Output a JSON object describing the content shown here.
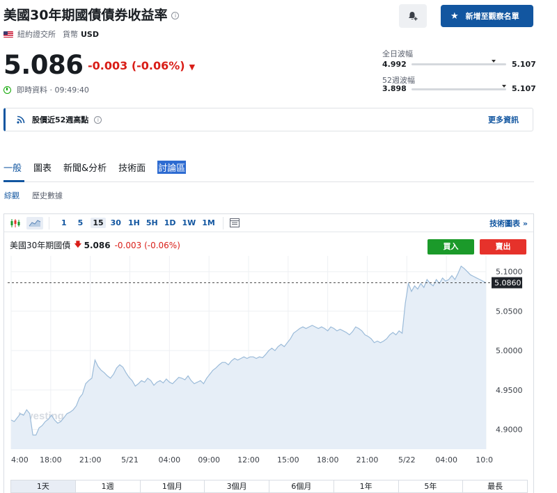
{
  "header": {
    "title": "美國30年期國債債券收益率",
    "info_glyph": "i",
    "exchange": "紐約證交所",
    "currency_label": "貨幣",
    "currency": "USD",
    "watchlist_button": "新增至觀察名單",
    "alert_icon": "bell-plus-icon"
  },
  "quote": {
    "price": "5.086",
    "change": "-0.003",
    "change_pct": "(-0.06%)",
    "status": "即時資料 · 09:49:40",
    "down_color": "#d91e18"
  },
  "ranges": {
    "day_label": "全日波幅",
    "day_low": "4.992",
    "day_high": "5.107",
    "day_position": 0.87,
    "week52_label": "52週波幅",
    "week52_low": "3.898",
    "week52_high": "5.107",
    "week52_position": 0.98
  },
  "alert_banner": {
    "text": "股價近52週高點",
    "more": "更多資訊"
  },
  "tabs": [
    "一般",
    "圖表",
    "新聞&分析",
    "技術面",
    "討論區"
  ],
  "subtabs": [
    "綜觀",
    "歷史數據"
  ],
  "toolbar": {
    "intervals": [
      "1",
      "5",
      "15",
      "30",
      "1H",
      "5H",
      "1D",
      "1W",
      "1M"
    ],
    "selected_interval": "15",
    "tech_link": "技術圖表 »"
  },
  "chart_legend": {
    "name": "美國30年期國債",
    "arrow": "🡇",
    "price": "5.086",
    "change": "-0.003",
    "change_pct": "(-0.06%)",
    "buy": "買入",
    "sell": "賣出"
  },
  "periods": [
    "1天",
    "1週",
    "1個月",
    "3個月",
    "6個月",
    "1年",
    "5年",
    "最長"
  ],
  "selected_period": "1天",
  "colors": {
    "brand_blue": "#1256a0",
    "buy_green": "#1b9a2a",
    "sell_red": "#e6322b",
    "area_line": "#9bbbd9",
    "area_fill": "#e6eef7"
  },
  "chart_data": {
    "type": "area",
    "series": [
      {
        "values": [
          4.912,
          4.91,
          4.915,
          4.92,
          4.918,
          4.925,
          4.92,
          4.893,
          4.893,
          4.902,
          4.905,
          4.91,
          4.913,
          4.918,
          4.912,
          4.908,
          4.91,
          4.915,
          4.92,
          4.922,
          4.925,
          4.93,
          4.94,
          4.945,
          4.958,
          4.962,
          4.965,
          4.988,
          4.98,
          4.975,
          4.972,
          4.968,
          4.965,
          4.97,
          4.978,
          4.982,
          4.979,
          4.972,
          4.966,
          4.962,
          4.955,
          4.958,
          4.962,
          4.96,
          4.965,
          4.962,
          4.956,
          4.96,
          4.962,
          4.959,
          4.964,
          4.96,
          4.958,
          4.962,
          4.966,
          4.965,
          4.963,
          4.968,
          4.962,
          4.958,
          4.96,
          4.962,
          4.958,
          4.965,
          4.97,
          4.975,
          4.978,
          4.982,
          4.985,
          4.985,
          4.982,
          4.987,
          4.99,
          4.988,
          4.99,
          4.992,
          4.99,
          4.992,
          4.992,
          4.99,
          4.992,
          4.991,
          4.995,
          5.0,
          5.003,
          5.0,
          5.005,
          5.008,
          5.005,
          5.01,
          5.015,
          5.022,
          5.025,
          5.028,
          5.03,
          5.028,
          5.03,
          5.032,
          5.03,
          5.028,
          5.03,
          5.028,
          5.025,
          5.03,
          5.028,
          5.025,
          5.027,
          5.025,
          5.023,
          5.02,
          5.024,
          5.03,
          5.028,
          5.025,
          5.02,
          5.018,
          5.015,
          5.01,
          5.012,
          5.01,
          5.012,
          5.015,
          5.02,
          5.023,
          5.02,
          5.025,
          5.022,
          5.06,
          5.085,
          5.075,
          5.082,
          5.078,
          5.085,
          5.08,
          5.09,
          5.085,
          5.082,
          5.09,
          5.085,
          5.092,
          5.088,
          5.09,
          5.095,
          5.09,
          5.098,
          5.107,
          5.104,
          5.1,
          5.096,
          5.094,
          5.092,
          5.09,
          5.088,
          5.086
        ]
      }
    ],
    "x_ticks": [
      "4:00",
      "18:00",
      "21:00",
      "5/21",
      "04:00",
      "09:00",
      "12:00",
      "15:00",
      "18:00",
      "21:00",
      "5/22",
      "04:00",
      "10:0"
    ],
    "y_ticks": [
      4.9,
      4.95,
      5.0,
      5.05,
      5.1
    ],
    "y_tick_labels": [
      "4.9000",
      "4.9500",
      "5.0000",
      "5.0500",
      "5.1000"
    ],
    "last_value_label": "5.0860",
    "ylim": [
      4.875,
      5.12
    ],
    "watermark": "Investing.com"
  }
}
